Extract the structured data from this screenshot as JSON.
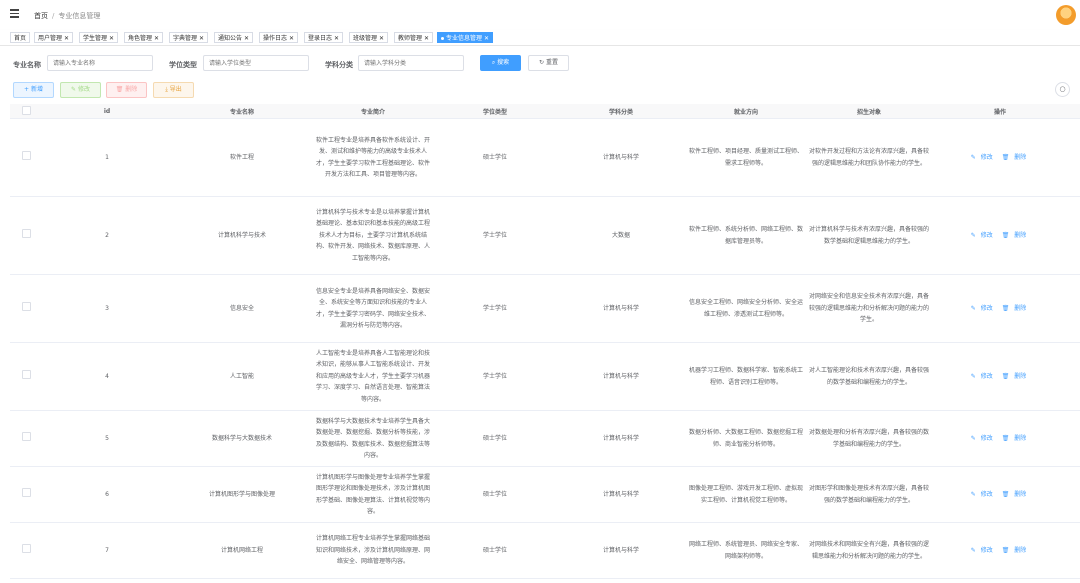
{
  "header": {
    "home": "首页",
    "current": "专业信息管理"
  },
  "tags": [
    {
      "label": "首页",
      "closable": false
    },
    {
      "label": "用户管理",
      "closable": true
    },
    {
      "label": "学生管理",
      "closable": true
    },
    {
      "label": "角色管理",
      "closable": true
    },
    {
      "label": "字典管理",
      "closable": true
    },
    {
      "label": "通知公告",
      "closable": true
    },
    {
      "label": "操作日志",
      "closable": true
    },
    {
      "label": "登录日志",
      "closable": true
    },
    {
      "label": "班级管理",
      "closable": true
    },
    {
      "label": "教师管理",
      "closable": true
    },
    {
      "label": "专业信息管理",
      "closable": true,
      "active": true
    }
  ],
  "search": {
    "name_label": "专业名称",
    "name_placeholder": "请输入专业名称",
    "degree_label": "学位类型",
    "degree_placeholder": "请输入学位类型",
    "category_label": "学科分类",
    "category_placeholder": "请输入学科分类",
    "search_btn": "搜索",
    "reset_btn": "重置"
  },
  "toolbar": {
    "add": "新增",
    "edit": "修改",
    "delete": "删除",
    "export": "导出"
  },
  "columns": [
    "id",
    "专业名称",
    "专业简介",
    "学位类型",
    "学科分类",
    "就业方向",
    "招生对象",
    "操作"
  ],
  "row_actions": {
    "edit": "修改",
    "delete": "删除"
  },
  "rows": [
    {
      "id": "1",
      "name": "软件工程",
      "intro": "软件工程专业是培养具备软件系统设计、开发、测试和维护等能力的高级专业技术人才，学生主要学习软件工程基础理论、软件开发方法和工具、项目管理等内容。",
      "degree": "硕士学位",
      "category": "计算机与科学",
      "career": "软件工程师、项目经理、质量测试工程师、需求工程师等。",
      "target": "对软件开发过程和方法论有浓厚兴趣，具备较强的逻辑思维能力和团队协作能力的学生。"
    },
    {
      "id": "2",
      "name": "计算机科学与技术",
      "intro": "计算机科学与技术专业是以培养掌握计算机基础理论、基本知识和基本技能的高级工程技术人才为目标，主要学习计算机系统结构、软件开发、网络技术、数据库原理、人工智能等内容。",
      "degree": "学士学位",
      "category": "大数据",
      "career": "软件工程师、系统分析师、网络工程师、数据库管理员等。",
      "target": "对计算机科学与技术有浓厚兴趣，具备较强的数学基础和逻辑思维能力的学生。"
    },
    {
      "id": "3",
      "name": "信息安全",
      "intro": "信息安全专业是培养具备网络安全、数据安全、系统安全等方面知识和技能的专业人才，学生主要学习密码学、网络安全技术、漏洞分析与防范等内容。",
      "degree": "学士学位",
      "category": "计算机与科学",
      "career": "信息安全工程师、网络安全分析师、安全运维工程师、渗透测试工程师等。",
      "target": "对网络安全和信息安全技术有浓厚兴趣，具备较强的逻辑思维能力和分析解决问题的能力的学生。"
    },
    {
      "id": "4",
      "name": "人工智能",
      "intro": "人工智能专业是培养具备人工智能理论和技术知识，能够从事人工智能系统设计、开发和应用的高级专业人才，学生主要学习机器学习、深度学习、自然语言处理、智能算法等内容。",
      "degree": "学士学位",
      "category": "计算机与科学",
      "career": "机器学习工程师、数据科学家、智能系统工程师、语音识别工程师等。",
      "target": "对人工智能理论和技术有浓厚兴趣，具备较强的数学基础和编程能力的学生。"
    },
    {
      "id": "5",
      "name": "数据科学与大数据技术",
      "intro": "数据科学与大数据技术专业培养学生具备大数据处理、数据挖掘、数据分析等技能，涉及数据结构、数据库技术、数据挖掘算法等内容。",
      "degree": "硕士学位",
      "category": "计算机与科学",
      "career": "数据分析师、大数据工程师、数据挖掘工程师、商业智能分析师等。",
      "target": "对数据处理和分析有浓厚兴趣，具备较强的数学基础和编程能力的学生。"
    },
    {
      "id": "6",
      "name": "计算机图形学与图像处理",
      "intro": "计算机图形学与图像处理专业培养学生掌握图形学理论和图像处理技术，涉及计算机图形学基础、图像处理算法、计算机视觉等内容。",
      "degree": "硕士学位",
      "category": "计算机与科学",
      "career": "图像处理工程师、游戏开发工程师、虚拟现实工程师、计算机视觉工程师等。",
      "target": "对图形学和图像处理技术有浓厚兴趣，具备较强的数学基础和编程能力的学生。"
    },
    {
      "id": "7",
      "name": "计算机网络工程",
      "intro": "计算机网络工程专业培养学生掌握网络基础知识和网络技术，涉及计算机网络原理、网络安全、网络管理等内容。",
      "degree": "硕士学位",
      "category": "计算机与科学",
      "career": "网络工程师、系统管理员、网络安全专家、网络架构师等。",
      "target": "对网络技术和网络安全有兴趣，具备较强的逻辑思维能力和分析解决问题的能力的学生。"
    }
  ]
}
